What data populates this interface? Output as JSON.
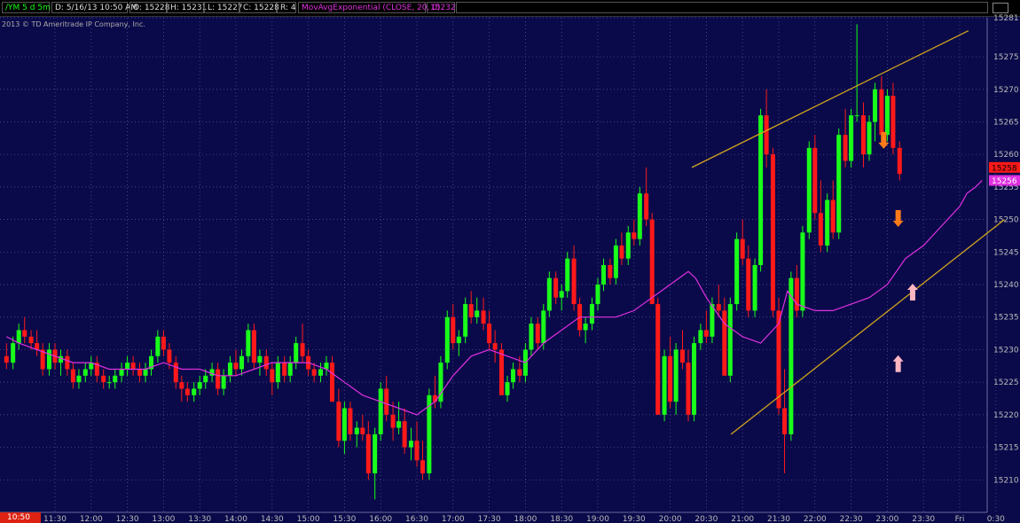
{
  "header": {
    "symbol": "/YM 5 d 5m",
    "date": "D: 5/16/13 10:50 AM",
    "open": "O: 15228",
    "high": "H: 15231",
    "low": "L: 15227",
    "close": "C: 15228",
    "range": "R: 4",
    "study": "MovAvgExponential (CLOSE, 20, 0)",
    "study_value": "15232"
  },
  "copyright": "2013 © TD Ameritrade IP Company, Inc.",
  "cursor_time": "10:50",
  "colors": {
    "background": "#0a0a4a",
    "up": "#19ff19",
    "down": "#ff1919",
    "ema": "#e030e0",
    "channel": "#d2a41c",
    "down_arrow": "#ff7a1a",
    "up_arrow": "#ffb6c1"
  },
  "chart_data": {
    "type": "candlestick",
    "ylim": [
      15205,
      15281
    ],
    "yticks": [
      15210,
      15215,
      15220,
      15225,
      15230,
      15235,
      15240,
      15245,
      15250,
      15255,
      15260,
      15265,
      15270,
      15275,
      15281
    ],
    "xtick_labels": [
      {
        "t": 11.5,
        "label": "11:30"
      },
      {
        "t": 12.0,
        "label": "12:00"
      },
      {
        "t": 12.5,
        "label": "12:30"
      },
      {
        "t": 13.0,
        "label": "13:00"
      },
      {
        "t": 13.5,
        "label": "13:30"
      },
      {
        "t": 14.0,
        "label": "14:00"
      },
      {
        "t": 14.5,
        "label": "14:30"
      },
      {
        "t": 15.0,
        "label": "15:00"
      },
      {
        "t": 15.5,
        "label": "15:30"
      },
      {
        "t": 16.0,
        "label": "16:00"
      },
      {
        "t": 16.5,
        "label": "16:30"
      },
      {
        "t": 17.0,
        "label": "17:00"
      },
      {
        "t": 17.5,
        "label": "17:30"
      },
      {
        "t": 18.0,
        "label": "18:00"
      },
      {
        "t": 18.5,
        "label": "18:30"
      },
      {
        "t": 19.0,
        "label": "19:00"
      },
      {
        "t": 19.5,
        "label": "19:30"
      },
      {
        "t": 20.0,
        "label": "20:00"
      },
      {
        "t": 20.5,
        "label": "20:30"
      },
      {
        "t": 21.0,
        "label": "21:00"
      },
      {
        "t": 21.5,
        "label": "21:30"
      },
      {
        "t": 22.0,
        "label": "22:00"
      },
      {
        "t": 22.5,
        "label": "22:30"
      },
      {
        "t": 23.0,
        "label": "23:00"
      },
      {
        "t": 23.5,
        "label": "23:30"
      },
      {
        "t": 24.0,
        "label": "Fri"
      },
      {
        "t": 24.5,
        "label": "0:30"
      }
    ],
    "price_markers": [
      {
        "value": 15258,
        "label": "15258",
        "color": "#ff1919",
        "text_color": "#000"
      },
      {
        "value": 15256,
        "label": "15256",
        "color": "#e030e0",
        "text_color": "#fff"
      }
    ],
    "trendlines": [
      {
        "t1": 20.3,
        "v1": 15258,
        "t2": 24.12,
        "v2": 15279
      },
      {
        "t1": 20.84,
        "v1": 15217,
        "t2": 24.62,
        "v2": 15250
      }
    ],
    "signals": [
      {
        "t": 22.95,
        "value": 15261,
        "dir": "down"
      },
      {
        "t": 23.15,
        "value": 15249,
        "dir": "down"
      },
      {
        "t": 23.35,
        "value": 15240,
        "dir": "up"
      },
      {
        "t": 23.15,
        "value": 15229,
        "dir": "up"
      }
    ],
    "ema": [
      [
        10.83,
        15232
      ],
      [
        11.0,
        15231
      ],
      [
        11.25,
        15230
      ],
      [
        11.5,
        15229
      ],
      [
        11.75,
        15228
      ],
      [
        12.0,
        15228
      ],
      [
        12.25,
        15227
      ],
      [
        12.5,
        15227
      ],
      [
        12.75,
        15227
      ],
      [
        13.0,
        15228
      ],
      [
        13.25,
        15227
      ],
      [
        13.5,
        15227
      ],
      [
        13.75,
        15226
      ],
      [
        14.0,
        15226
      ],
      [
        14.25,
        15227
      ],
      [
        14.5,
        15228
      ],
      [
        14.75,
        15228
      ],
      [
        15.0,
        15228
      ],
      [
        15.25,
        15227
      ],
      [
        15.5,
        15225
      ],
      [
        15.75,
        15223
      ],
      [
        16.0,
        15222
      ],
      [
        16.25,
        15221
      ],
      [
        16.5,
        15220
      ],
      [
        16.75,
        15222
      ],
      [
        17.0,
        15226
      ],
      [
        17.25,
        15229
      ],
      [
        17.5,
        15230
      ],
      [
        17.75,
        15229
      ],
      [
        18.0,
        15228
      ],
      [
        18.25,
        15231
      ],
      [
        18.5,
        15233
      ],
      [
        18.75,
        15235
      ],
      [
        19.0,
        15235
      ],
      [
        19.25,
        15235
      ],
      [
        19.5,
        15236
      ],
      [
        19.75,
        15238
      ],
      [
        20.0,
        15240
      ],
      [
        20.25,
        15242
      ],
      [
        20.35,
        15241
      ],
      [
        20.5,
        15238
      ],
      [
        20.75,
        15234
      ],
      [
        21.0,
        15232
      ],
      [
        21.25,
        15231
      ],
      [
        21.5,
        15234
      ],
      [
        21.62,
        15239
      ],
      [
        21.75,
        15237
      ],
      [
        22.0,
        15236
      ],
      [
        22.25,
        15236
      ],
      [
        22.5,
        15237
      ],
      [
        22.75,
        15238
      ],
      [
        23.0,
        15240
      ],
      [
        23.25,
        15244
      ],
      [
        23.5,
        15246
      ],
      [
        23.75,
        15249
      ],
      [
        24.0,
        15252
      ],
      [
        24.1,
        15254
      ],
      [
        24.22,
        15255
      ],
      [
        24.31,
        15256
      ]
    ],
    "candles": [
      [
        10.83,
        15229,
        15231,
        15227,
        15228
      ],
      [
        10.92,
        15228,
        15232,
        15227,
        15231
      ],
      [
        11.0,
        15231,
        15234,
        15230,
        15233
      ],
      [
        11.08,
        15233,
        15235,
        15231,
        15232
      ],
      [
        11.17,
        15232,
        15233,
        15230,
        15231
      ],
      [
        11.25,
        15231,
        15233,
        15229,
        15230
      ],
      [
        11.33,
        15230,
        15231,
        15226,
        15227
      ],
      [
        11.42,
        15227,
        15231,
        15226,
        15230
      ],
      [
        11.5,
        15230,
        15231,
        15227,
        15228
      ],
      [
        11.58,
        15228,
        15230,
        15226,
        15229
      ],
      [
        11.67,
        15229,
        15230,
        15226,
        15227
      ],
      [
        11.75,
        15227,
        15228,
        15224,
        15225
      ],
      [
        11.83,
        15225,
        15227,
        15224,
        15226
      ],
      [
        11.92,
        15226,
        15228,
        15225,
        15227
      ],
      [
        12.0,
        15227,
        15229,
        15226,
        15228
      ],
      [
        12.08,
        15228,
        15229,
        15225,
        15226
      ],
      [
        12.17,
        15226,
        15227,
        15224,
        15225
      ],
      [
        12.25,
        15225,
        15226,
        15224,
        15225
      ],
      [
        12.33,
        15225,
        15227,
        15224,
        15226
      ],
      [
        12.42,
        15226,
        15228,
        15225,
        15227
      ],
      [
        12.5,
        15227,
        15229,
        15226,
        15228
      ],
      [
        12.58,
        15228,
        15229,
        15226,
        15227
      ],
      [
        12.67,
        15227,
        15228,
        15225,
        15226
      ],
      [
        12.75,
        15226,
        15228,
        15225,
        15227
      ],
      [
        12.83,
        15227,
        15230,
        15226,
        15229
      ],
      [
        12.92,
        15229,
        15233,
        15228,
        15232
      ],
      [
        13.0,
        15232,
        15233,
        15229,
        15230
      ],
      [
        13.08,
        15230,
        15231,
        15227,
        15228
      ],
      [
        13.17,
        15228,
        15229,
        15224,
        15225
      ],
      [
        13.25,
        15225,
        15226,
        15222,
        15224
      ],
      [
        13.33,
        15224,
        15225,
        15222,
        15223
      ],
      [
        13.42,
        15223,
        15225,
        15222,
        15224
      ],
      [
        13.5,
        15224,
        15226,
        15223,
        15225
      ],
      [
        13.58,
        15225,
        15227,
        15224,
        15226
      ],
      [
        13.67,
        15226,
        15228,
        15225,
        15227
      ],
      [
        13.75,
        15227,
        15228,
        15223,
        15224
      ],
      [
        13.83,
        15224,
        15227,
        15223,
        15226
      ],
      [
        13.92,
        15226,
        15229,
        15225,
        15228
      ],
      [
        14.0,
        15228,
        15230,
        15226,
        15227
      ],
      [
        14.08,
        15227,
        15230,
        15226,
        15229
      ],
      [
        14.17,
        15229,
        15234,
        15228,
        15233
      ],
      [
        14.25,
        15233,
        15234,
        15227,
        15228
      ],
      [
        14.33,
        15228,
        15230,
        15226,
        15229
      ],
      [
        14.42,
        15229,
        15230,
        15226,
        15227
      ],
      [
        14.5,
        15227,
        15228,
        15223,
        15225
      ],
      [
        14.58,
        15225,
        15229,
        15224,
        15228
      ],
      [
        14.67,
        15228,
        15229,
        15225,
        15226
      ],
      [
        14.75,
        15226,
        15229,
        15225,
        15228
      ],
      [
        14.83,
        15228,
        15232,
        15227,
        15231
      ],
      [
        14.92,
        15231,
        15234,
        15228,
        15229
      ],
      [
        15.0,
        15229,
        15230,
        15226,
        15227
      ],
      [
        15.08,
        15227,
        15228,
        15225,
        15226
      ],
      [
        15.17,
        15226,
        15228,
        15225,
        15227
      ],
      [
        15.25,
        15227,
        15229,
        15226,
        15228
      ],
      [
        15.33,
        15228,
        15229,
        15223,
        15222
      ],
      [
        15.42,
        15222,
        15224,
        15215,
        15216
      ],
      [
        15.5,
        15216,
        15222,
        15214,
        15221
      ],
      [
        15.58,
        15221,
        15222,
        15216,
        15217
      ],
      [
        15.67,
        15217,
        15219,
        15215,
        15218
      ],
      [
        15.75,
        15218,
        15220,
        15216,
        15217
      ],
      [
        15.83,
        15217,
        15219,
        15210,
        15211
      ],
      [
        15.92,
        15211,
        15218,
        15207,
        15217
      ],
      [
        16.0,
        15217,
        15225,
        15216,
        15224
      ],
      [
        16.08,
        15224,
        15226,
        15219,
        15220
      ],
      [
        16.17,
        15220,
        15222,
        15216,
        15218
      ],
      [
        16.25,
        15218,
        15222,
        15217,
        15219
      ],
      [
        16.33,
        15219,
        15221,
        15214,
        15215
      ],
      [
        16.42,
        15215,
        15218,
        15213,
        15216
      ],
      [
        16.5,
        15216,
        15219,
        15212,
        15213
      ],
      [
        16.58,
        15213,
        15216,
        15210,
        15211
      ],
      [
        16.67,
        15211,
        15224,
        15210,
        15223
      ],
      [
        16.75,
        15223,
        15226,
        15221,
        15222
      ],
      [
        16.83,
        15222,
        15229,
        15221,
        15228
      ],
      [
        16.92,
        15228,
        15236,
        15227,
        15235
      ],
      [
        17.0,
        15235,
        15237,
        15230,
        15231
      ],
      [
        17.08,
        15231,
        15233,
        15229,
        15232
      ],
      [
        17.17,
        15232,
        15238,
        15231,
        15237
      ],
      [
        17.25,
        15237,
        15239,
        15234,
        15235
      ],
      [
        17.33,
        15235,
        15238,
        15234,
        15236
      ],
      [
        17.42,
        15236,
        15238,
        15233,
        15234
      ],
      [
        17.5,
        15234,
        15236,
        15230,
        15231
      ],
      [
        17.58,
        15231,
        15233,
        15228,
        15230
      ],
      [
        17.67,
        15230,
        15231,
        15224,
        15223
      ],
      [
        17.75,
        15223,
        15226,
        15222,
        15225
      ],
      [
        17.83,
        15225,
        15228,
        15224,
        15227
      ],
      [
        17.92,
        15227,
        15229,
        15225,
        15226
      ],
      [
        18.0,
        15226,
        15231,
        15225,
        15230
      ],
      [
        18.08,
        15230,
        15235,
        15229,
        15234
      ],
      [
        18.17,
        15234,
        15235,
        15230,
        15231
      ],
      [
        18.25,
        15231,
        15237,
        15230,
        15236
      ],
      [
        18.33,
        15236,
        15242,
        15235,
        15241
      ],
      [
        18.42,
        15241,
        15242,
        15237,
        15238
      ],
      [
        18.5,
        15238,
        15240,
        15236,
        15239
      ],
      [
        18.58,
        15239,
        15245,
        15238,
        15244
      ],
      [
        18.67,
        15244,
        15246,
        15236,
        15237
      ],
      [
        18.75,
        15237,
        15238,
        15232,
        15233
      ],
      [
        18.83,
        15233,
        15235,
        15231,
        15234
      ],
      [
        18.92,
        15234,
        15238,
        15233,
        15237
      ],
      [
        19.0,
        15237,
        15241,
        15236,
        15240
      ],
      [
        19.08,
        15240,
        15244,
        15239,
        15243
      ],
      [
        19.17,
        15243,
        15244,
        15240,
        15241
      ],
      [
        19.25,
        15241,
        15247,
        15240,
        15246
      ],
      [
        19.33,
        15246,
        15248,
        15243,
        15244
      ],
      [
        19.42,
        15244,
        15249,
        15243,
        15248
      ],
      [
        19.5,
        15248,
        15250,
        15246,
        15247
      ],
      [
        19.58,
        15247,
        15255,
        15246,
        15254
      ],
      [
        19.67,
        15254,
        15258,
        15249,
        15250
      ],
      [
        19.75,
        15250,
        15251,
        15241,
        15237
      ],
      [
        19.83,
        15237,
        15238,
        15226,
        15220
      ],
      [
        19.92,
        15220,
        15230,
        15219,
        15229
      ],
      [
        20.0,
        15229,
        15232,
        15221,
        15222
      ],
      [
        20.08,
        15222,
        15231,
        15220,
        15230
      ],
      [
        20.17,
        15230,
        15233,
        15227,
        15228
      ],
      [
        20.25,
        15228,
        15230,
        15219,
        15220
      ],
      [
        20.33,
        15220,
        15232,
        15219,
        15231
      ],
      [
        20.42,
        15231,
        15234,
        15230,
        15233
      ],
      [
        20.5,
        15233,
        15236,
        15231,
        15232
      ],
      [
        20.58,
        15232,
        15238,
        15231,
        15237
      ],
      [
        20.67,
        15237,
        15240,
        15235,
        15236
      ],
      [
        20.75,
        15236,
        15238,
        15227,
        15226
      ],
      [
        20.83,
        15226,
        15238,
        15225,
        15237
      ],
      [
        20.92,
        15237,
        15248,
        15236,
        15247
      ],
      [
        21.0,
        15247,
        15250,
        15243,
        15244
      ],
      [
        21.08,
        15244,
        15246,
        15235,
        15236
      ],
      [
        21.17,
        15236,
        15244,
        15235,
        15243
      ],
      [
        21.25,
        15243,
        15267,
        15242,
        15266
      ],
      [
        21.33,
        15266,
        15270,
        15258,
        15260
      ],
      [
        21.42,
        15260,
        15261,
        15235,
        15236
      ],
      [
        21.5,
        15236,
        15238,
        15220,
        15221
      ],
      [
        21.58,
        15221,
        15227,
        15211,
        15217
      ],
      [
        21.67,
        15217,
        15242,
        15216,
        15241
      ],
      [
        21.75,
        15241,
        15243,
        15235,
        15236
      ],
      [
        21.83,
        15236,
        15249,
        15235,
        15248
      ],
      [
        21.92,
        15248,
        15262,
        15247,
        15261
      ],
      [
        22.0,
        15261,
        15263,
        15250,
        15251
      ],
      [
        22.08,
        15251,
        15256,
        15245,
        15246
      ],
      [
        22.17,
        15246,
        15254,
        15245,
        15253
      ],
      [
        22.25,
        15253,
        15256,
        15247,
        15248
      ],
      [
        22.33,
        15248,
        15264,
        15247,
        15263
      ],
      [
        22.42,
        15263,
        15267,
        15258,
        15259
      ],
      [
        22.5,
        15259,
        15267,
        15258,
        15266
      ],
      [
        22.58,
        15266,
        15280,
        15265,
        15266
      ],
      [
        22.67,
        15266,
        15268,
        15258,
        15260
      ],
      [
        22.75,
        15260,
        15266,
        15259,
        15265
      ],
      [
        22.83,
        15265,
        15271,
        15262,
        15270
      ],
      [
        22.92,
        15270,
        15272,
        15262,
        15263
      ],
      [
        23.0,
        15263,
        15270,
        15262,
        15269
      ],
      [
        23.08,
        15269,
        15271,
        15260,
        15261
      ],
      [
        23.17,
        15261,
        15262,
        15256,
        15257
      ]
    ]
  }
}
